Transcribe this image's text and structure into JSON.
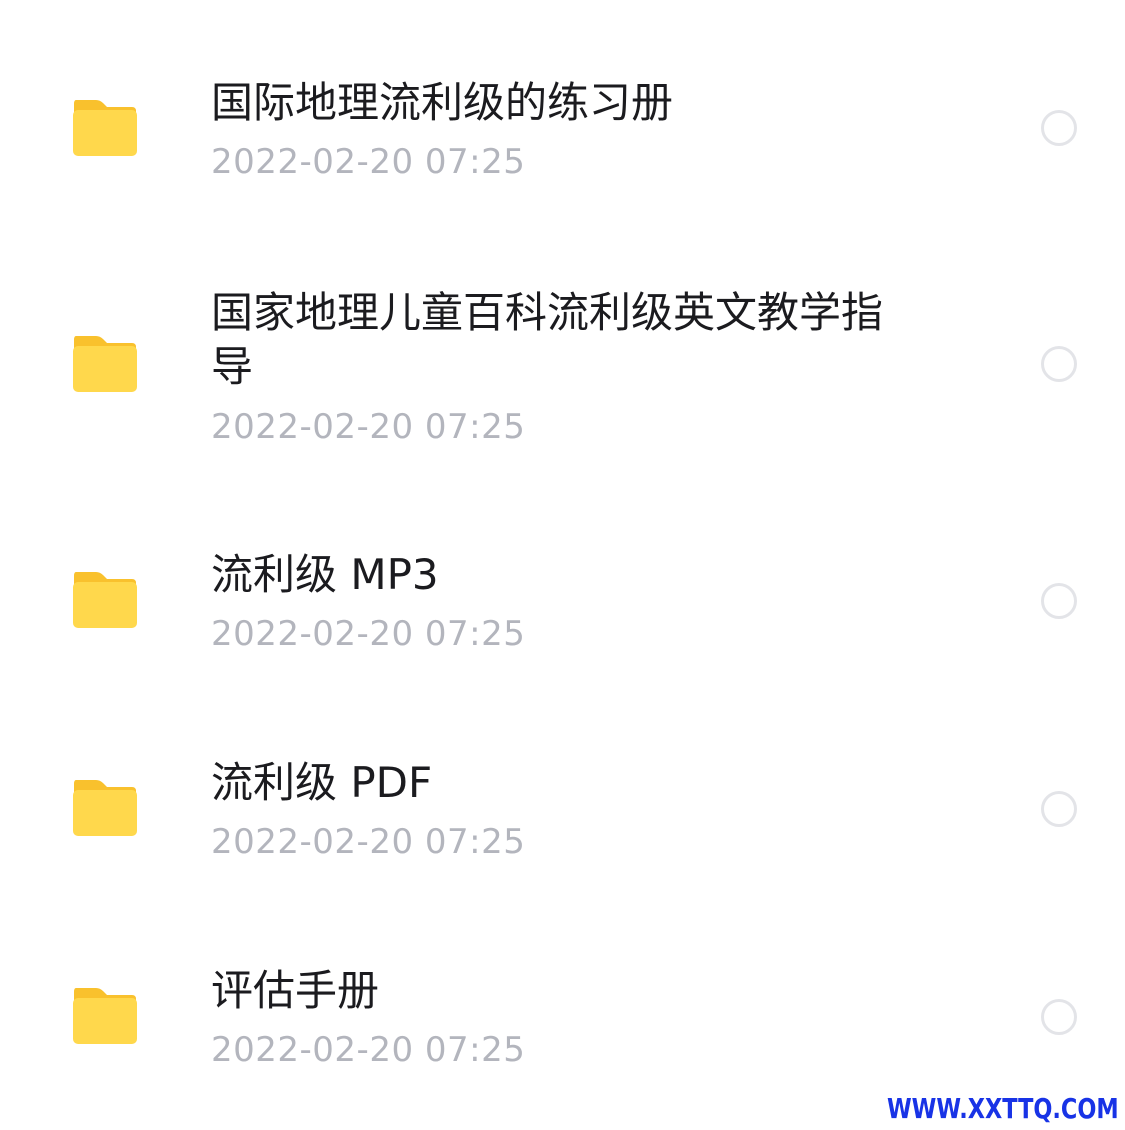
{
  "files": [
    {
      "name": "国际地理流利级的练习册",
      "date": "2022-02-20 07:25",
      "icon": "folder-icon"
    },
    {
      "name": "国家地理儿童百科流利级英文教学指导",
      "date": "2022-02-20 07:25",
      "icon": "folder-icon"
    },
    {
      "name": "流利级 MP3",
      "date": "2022-02-20 07:25",
      "icon": "folder-icon"
    },
    {
      "name": "流利级 PDF",
      "date": "2022-02-20 07:25",
      "icon": "folder-icon"
    },
    {
      "name": "评估手册",
      "date": "2022-02-20 07:25",
      "icon": "folder-icon"
    }
  ],
  "watermark": "WWW.XXTTQ.COM",
  "colors": {
    "folder_front": "#FFD84C",
    "folder_back": "#F9C12D",
    "title_text": "#1B1B1F",
    "date_text": "#B3B5BD",
    "radio_border": "#E3E4E8",
    "watermark": "#1833E6"
  }
}
